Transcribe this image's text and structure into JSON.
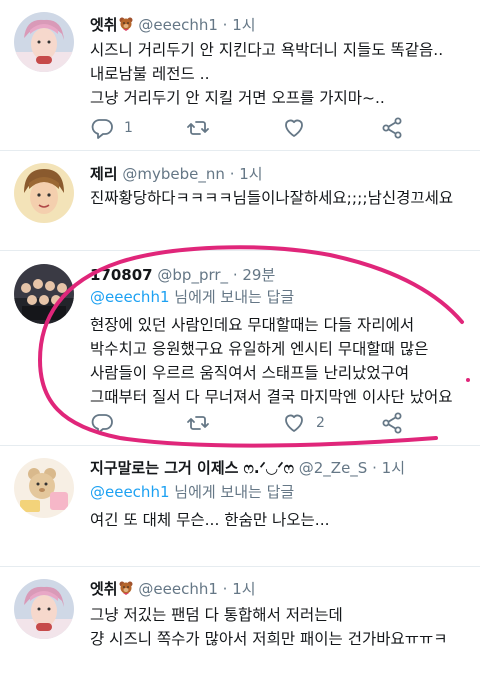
{
  "tweets": [
    {
      "name": "엣취",
      "handle": "@eeechh1",
      "separator": "·",
      "time": "1시",
      "reply_prefix": "",
      "reply_handle": "",
      "reply_suffix": "",
      "lines": [
        "시즈니 거리두기 안 지킨다고 욕박더니 지들도 똑같음..",
        "내로남불 레전드 ..",
        "그냥 거리두기 안 지킬 거면 오프를 가지마~.."
      ],
      "reply_count": "1",
      "retweet_count": "",
      "like_count": ""
    },
    {
      "name": "제리",
      "handle": "@mybebe_nn",
      "separator": "·",
      "time": "1시",
      "lines": [
        "진짜황당하다ㅋㅋㅋㅋ님들이나잘하세요;;;;남신경끄세요"
      ],
      "reply_count": "",
      "retweet_count": "",
      "like_count": ""
    },
    {
      "name": "170807",
      "handle": "@bp_prr_",
      "separator": "·",
      "time": "29분",
      "reply_prefix": "",
      "reply_handle": "@eeechh1",
      "reply_suffix": " 님에게 보내는 답글",
      "lines": [
        "현장에 있던 사람인데요 무대할때는 다들 자리에서",
        "박수치고 응원했구요 유일하게 엔시티 무대할때 많은",
        "사람들이 우르르 움직여서 스태프들 난리났었구여",
        "그때부터 질서 다 무너져서 결국 마지막엔 이사단 났어요"
      ],
      "reply_count": "",
      "retweet_count": "",
      "like_count": "2"
    },
    {
      "name": "지구말로는 그거 이제스 ෆ.ᐟ◡ᐟෆ",
      "handle": "@2_Ze_S",
      "separator": "·",
      "time": "1시",
      "reply_handle": "@eeechh1",
      "reply_suffix": " 님에게 보내는 답글",
      "lines": [
        "여긴 또 대체 무슨... 한숨만 나오는..."
      ],
      "reply_count": "",
      "retweet_count": "",
      "like_count": ""
    },
    {
      "name": "엣취",
      "handle": "@eeechh1",
      "separator": "·",
      "time": "1시",
      "lines": [
        "그냥 저깄는 팬덤 다 통합해서 저러는데",
        "걍 시즈니 쪽수가 많아서 저희만 패이는 건가바요ㅠㅠㅋ"
      ],
      "reply_count": "",
      "retweet_count": "",
      "like_count": ""
    }
  ],
  "icons": {
    "reply": "reply-icon",
    "retweet": "retweet-icon",
    "like": "heart-icon",
    "share": "share-icon",
    "name_emoji": "teddy-bear-icon"
  },
  "colors": {
    "accent": "#1da1f2",
    "secondary_text": "#657786",
    "annotation": "#e0267a",
    "divider": "#e6ecf0"
  }
}
